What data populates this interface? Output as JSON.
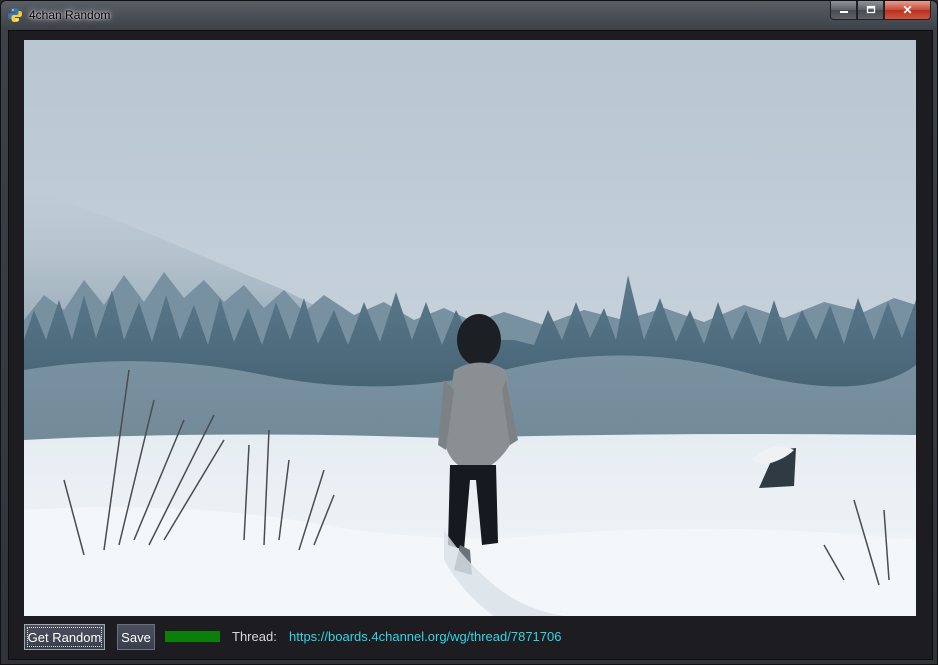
{
  "window": {
    "title": "4chan Random",
    "icon": "python-icon",
    "controls": {
      "minimize": "minimize-icon",
      "maximize": "maximize-icon",
      "close_glyph": "✕"
    }
  },
  "toolbar": {
    "get_random_label": "Get Random",
    "save_label": "Save",
    "progress_percent": 100,
    "progress_color": "#0a7f0a",
    "thread_label": "Thread:",
    "thread_url": "https://boards.4channel.org/wg/thread/7871706"
  },
  "colors": {
    "background": "#1c1c21",
    "link": "#2fd6e6",
    "button_bg": "#3f4352"
  }
}
